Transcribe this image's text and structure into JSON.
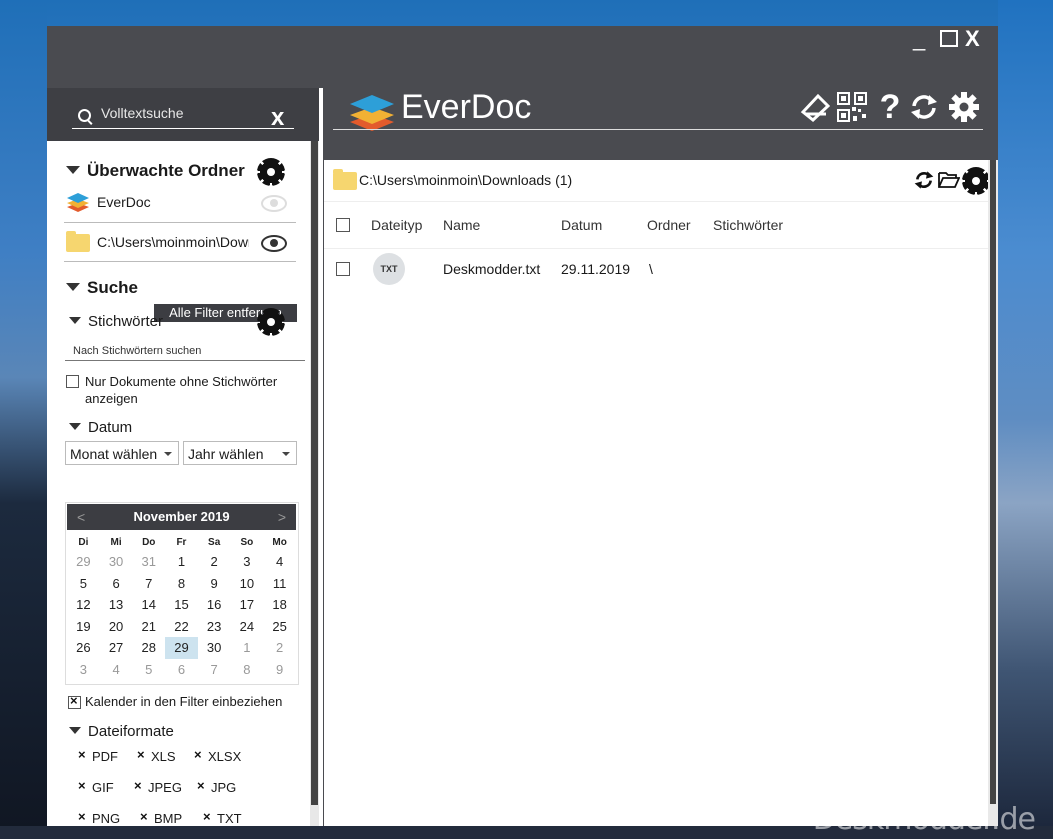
{
  "window": {
    "min_glyph": "_",
    "close_glyph": "X"
  },
  "search": {
    "placeholder": "Volltextsuche",
    "clear_glyph": "x"
  },
  "sidebar": {
    "watched_title": "Überwachte Ordner",
    "folders": [
      {
        "label": "EverDoc",
        "visible": false
      },
      {
        "label": "C:\\Users\\moinmoin\\Downloads",
        "visible": true
      }
    ],
    "search_title": "Suche",
    "remove_filters_label": "Alle Filter entfernen",
    "keywords_title": "Stichwörter",
    "keywords_placeholder": "Nach Stichwörtern suchen",
    "no_keywords_label": "Nur Dokumente ohne Stichwörter anzeigen",
    "date_title": "Datum",
    "month_select": "Monat wählen",
    "year_select": "Jahr wählen",
    "calendar": {
      "title": "November 2019",
      "prev": "<",
      "next": ">",
      "weekdays": [
        "Di",
        "Mi",
        "Do",
        "Fr",
        "Sa",
        "So",
        "Mo"
      ],
      "weeks": [
        [
          "29",
          "30",
          "31",
          "1",
          "2",
          "3",
          "4"
        ],
        [
          "5",
          "6",
          "7",
          "8",
          "9",
          "10",
          "11"
        ],
        [
          "12",
          "13",
          "14",
          "15",
          "16",
          "17",
          "18"
        ],
        [
          "19",
          "20",
          "21",
          "22",
          "23",
          "24",
          "25"
        ],
        [
          "26",
          "27",
          "28",
          "29",
          "30",
          "1",
          "2"
        ],
        [
          "3",
          "4",
          "5",
          "6",
          "7",
          "8",
          "9"
        ]
      ],
      "selected": "29"
    },
    "include_calendar_label": "Kalender in den Filter einbeziehen",
    "formats_title": "Dateiformate",
    "formats": [
      [
        "PDF",
        "XLS",
        "XLSX"
      ],
      [
        "GIF",
        "JPEG",
        "JPG"
      ],
      [
        "PNG",
        "BMP",
        "TXT"
      ]
    ]
  },
  "header": {
    "app_title": "EverDoc"
  },
  "main": {
    "path": "C:\\Users\\moinmoin\\Downloads (1)",
    "columns": {
      "type": "Dateityp",
      "name": "Name",
      "date": "Datum",
      "folder": "Ordner",
      "keywords": "Stichwörter"
    },
    "rows": [
      {
        "type": "TXT",
        "name": "Deskmodder.txt",
        "date": "29.11.2019",
        "folder": "\\",
        "keywords": ""
      }
    ]
  },
  "watermark": "Deskmodder.de",
  "colors": {
    "chrome": "#4a4b50",
    "dark_button": "#3c3d42",
    "folder": "#f6d66f",
    "calendar_selected": "#cde3ef"
  }
}
